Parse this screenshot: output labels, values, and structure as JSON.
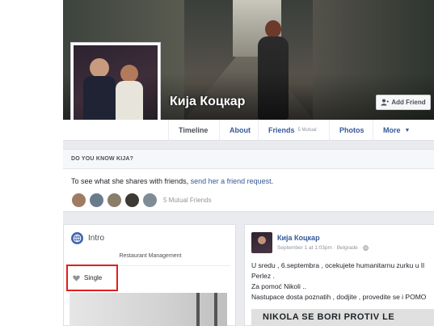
{
  "profile": {
    "name": "Кија Коцкар",
    "add_friend_label": "Add Friend"
  },
  "tabs": [
    {
      "label": "Timeline"
    },
    {
      "label": "About"
    },
    {
      "label": "Friends",
      "badge": "5 Mutual"
    },
    {
      "label": "Photos"
    },
    {
      "label": "More"
    }
  ],
  "do_you_know": {
    "header": "DO YOU KNOW KIJA?",
    "message_prefix": "To see what she shares with friends, ",
    "message_link": "send her a friend request",
    "message_suffix": ".",
    "mutual_text": "5 Mutual Friends",
    "mutual_avatar_colors": [
      "#a07a62",
      "#6b7b8e",
      "#8a7d6a",
      "#3d3a36",
      "#7f8c96"
    ]
  },
  "intro": {
    "title": "Intro",
    "role": "Restaurant Management",
    "relationship": "Single",
    "highlight_color": "#e0201d"
  },
  "post": {
    "author": "Кија Коцкар",
    "meta": "September 1 at 1:03pm · Belgrade · ",
    "lines": [
      "U sredu , 6.septembra , ocekujete humanitarnu zurku u Il",
      "Perlez .",
      "Za pomoć Nikoli ..",
      "Nastupace dosta poznatih , dodjite , provedite se i POMO"
    ],
    "image_text": "NIKOLA SE BORI PROTIV LE"
  },
  "colors": {
    "link": "#365899",
    "brand": "#4267b2",
    "background": "#e9ebee"
  }
}
